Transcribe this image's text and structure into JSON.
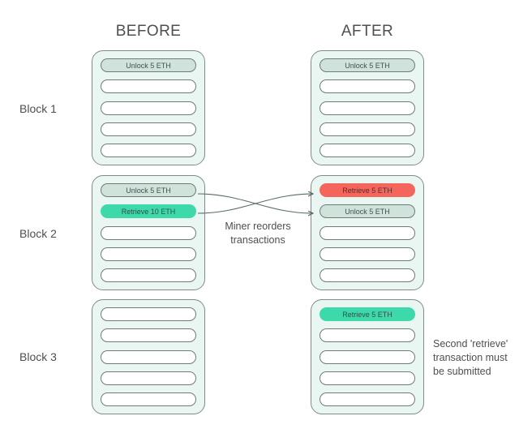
{
  "columns": {
    "before_label": "BEFORE",
    "after_label": "AFTER"
  },
  "row_labels": [
    "Block 1",
    "Block 2",
    "Block 3"
  ],
  "annotation": {
    "line1": "Miner reorders",
    "line2": "transactions"
  },
  "side_caption": {
    "line1": "Second 'retrieve'",
    "line2": "transaction must",
    "line3": "be submitted"
  },
  "colors": {
    "block_fill": "#eaf6f2",
    "block_border": "#7f8c8d",
    "tx_empty_fill": "#ffffff",
    "tx_border": "#6e7b7b",
    "tx_pale_green": "#cfe3da",
    "tx_green": "#3ed9ab",
    "tx_red": "#f4665c",
    "text": "#4f4f4f",
    "arrow": "#5a6a6a",
    "background": "#ffffff"
  },
  "blocks": {
    "before": [
      {
        "name": "Block 1",
        "transactions": [
          {
            "label": "Unlock 5 ETH",
            "style": "pale"
          },
          {
            "label": "",
            "style": "empty"
          },
          {
            "label": "",
            "style": "empty"
          },
          {
            "label": "",
            "style": "empty"
          },
          {
            "label": "",
            "style": "empty"
          }
        ]
      },
      {
        "name": "Block 2",
        "transactions": [
          {
            "label": "Unlock 5 ETH",
            "style": "pale"
          },
          {
            "label": "Retrieve 10 ETH",
            "style": "green"
          },
          {
            "label": "",
            "style": "empty"
          },
          {
            "label": "",
            "style": "empty"
          },
          {
            "label": "",
            "style": "empty"
          }
        ]
      },
      {
        "name": "Block 3",
        "transactions": [
          {
            "label": "",
            "style": "empty"
          },
          {
            "label": "",
            "style": "empty"
          },
          {
            "label": "",
            "style": "empty"
          },
          {
            "label": "",
            "style": "empty"
          },
          {
            "label": "",
            "style": "empty"
          }
        ]
      }
    ],
    "after": [
      {
        "name": "Block 1",
        "transactions": [
          {
            "label": "Unlock 5 ETH",
            "style": "pale"
          },
          {
            "label": "",
            "style": "empty"
          },
          {
            "label": "",
            "style": "empty"
          },
          {
            "label": "",
            "style": "empty"
          },
          {
            "label": "",
            "style": "empty"
          }
        ]
      },
      {
        "name": "Block 2",
        "transactions": [
          {
            "label": "Retrieve 5 ETH",
            "style": "red"
          },
          {
            "label": "Unlock 5 ETH",
            "style": "pale"
          },
          {
            "label": "",
            "style": "empty"
          },
          {
            "label": "",
            "style": "empty"
          },
          {
            "label": "",
            "style": "empty"
          }
        ]
      },
      {
        "name": "Block 3",
        "transactions": [
          {
            "label": "Retrieve 5 ETH",
            "style": "green"
          },
          {
            "label": "",
            "style": "empty"
          },
          {
            "label": "",
            "style": "empty"
          },
          {
            "label": "",
            "style": "empty"
          },
          {
            "label": "",
            "style": "empty"
          }
        ]
      }
    ]
  }
}
